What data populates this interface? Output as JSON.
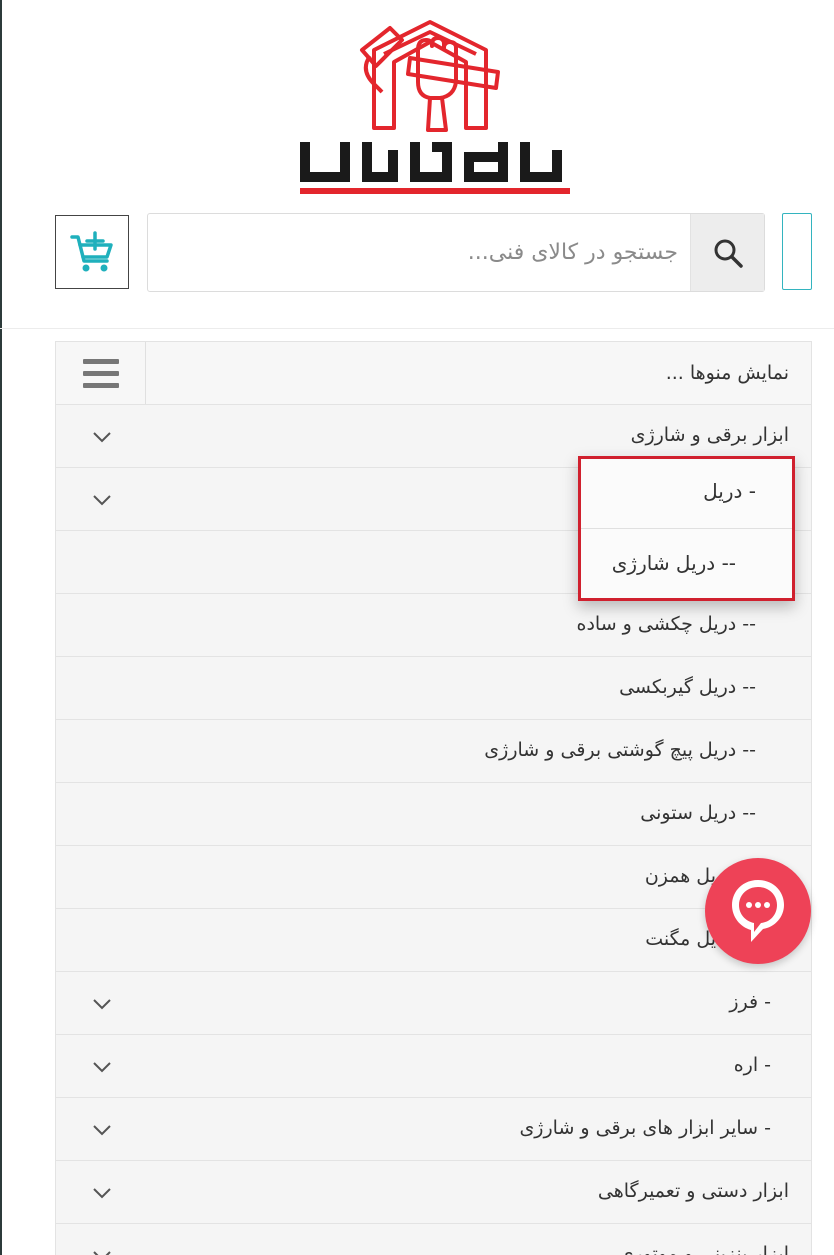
{
  "brand": {
    "logo_text": "کالای فنی",
    "primary_color": "#e3262d",
    "accent_color": "#33b4bf"
  },
  "search": {
    "placeholder": "جستجو در کالای فنی...",
    "value": "",
    "icon": "search-icon"
  },
  "cart": {
    "icon": "cart-add-icon"
  },
  "menu": {
    "header_label": "نمایش منوها ...",
    "toggle_icon": "hamburger-icon",
    "items": [
      {
        "label": "ابزار برقی و شارژی",
        "expandable": true
      },
      {
        "label": "",
        "expandable": true
      },
      {
        "label": "",
        "expandable": false
      },
      {
        "label": "-- دریل چکشی و ساده",
        "expandable": false
      },
      {
        "label": "-- دریل گیربکسی",
        "expandable": false
      },
      {
        "label": "-- دریل پیچ گوشتی برقی و شارژی",
        "expandable": false
      },
      {
        "label": "-- دریل ستونی",
        "expandable": false
      },
      {
        "label": "یل همزن",
        "expandable": false
      },
      {
        "label": "یل مگنت",
        "expandable": false
      },
      {
        "label": "- فرز",
        "expandable": true
      },
      {
        "label": "- اره",
        "expandable": true
      },
      {
        "label": "- سایر ابزار های برقی و شارژی",
        "expandable": true
      },
      {
        "label": "ابزار دستی و تعمیرگاهی",
        "expandable": true
      },
      {
        "label": "ابزار بنزینی و موتوری",
        "expandable": true
      }
    ]
  },
  "popup": {
    "border_color": "#d0202e",
    "items": [
      {
        "label": "- دریل"
      },
      {
        "label": "-- دریل شارژی"
      }
    ]
  },
  "chat": {
    "icon": "chat-icon",
    "color": "#ee4257"
  }
}
